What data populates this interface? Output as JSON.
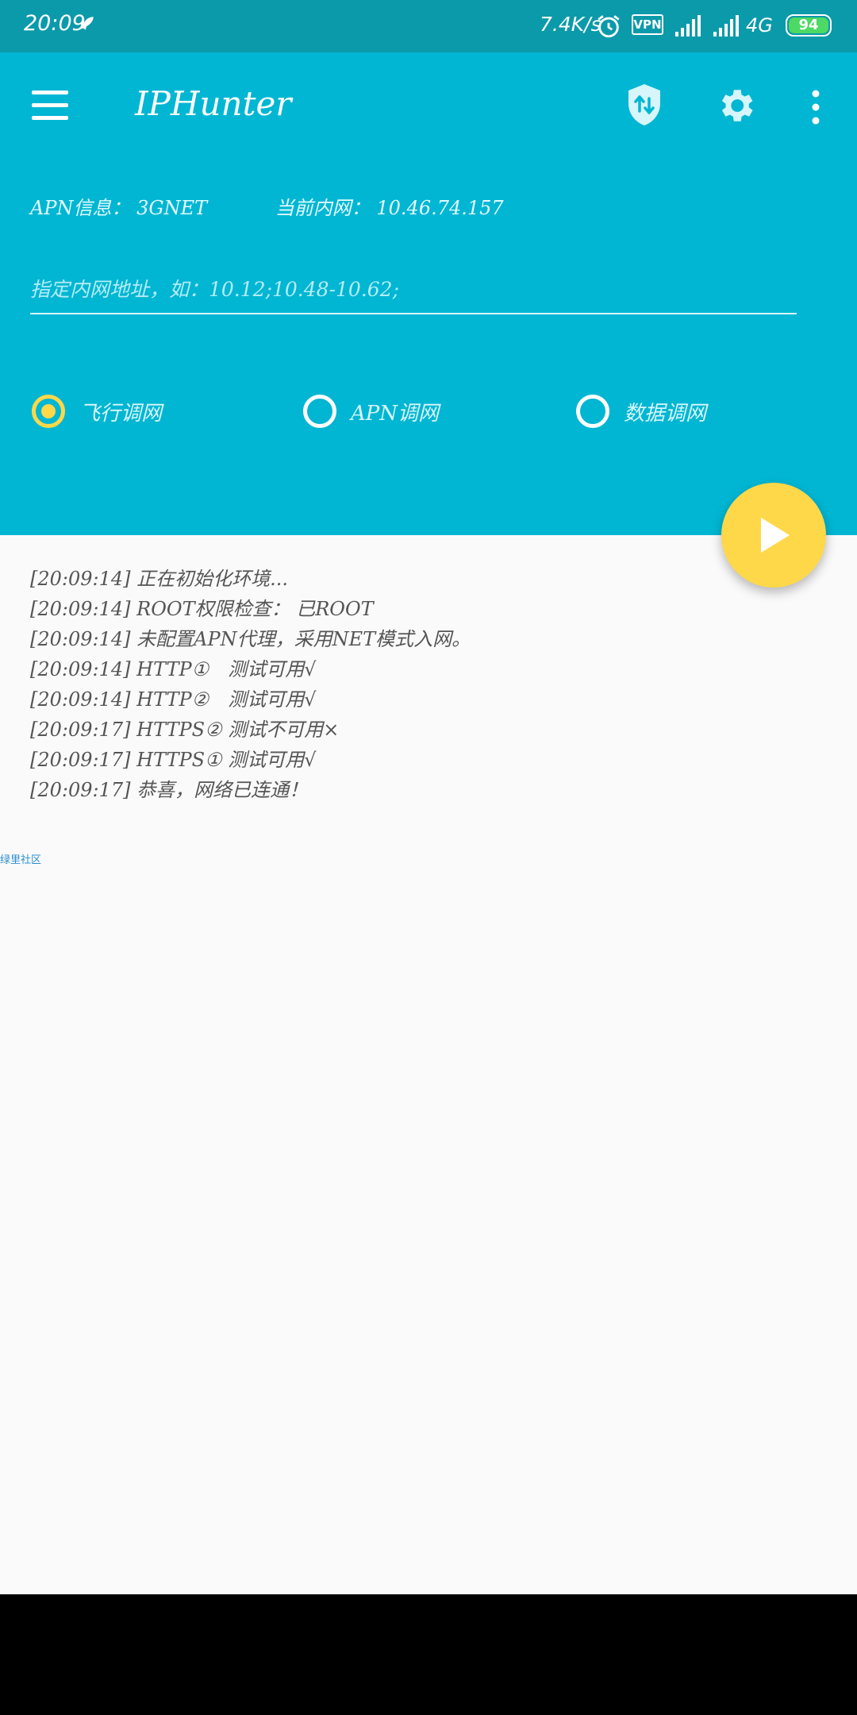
{
  "status_bar": {
    "time": "20:09",
    "net_speed": "7.4K/s",
    "vpn_label": "VPN",
    "network_type": "4G",
    "battery_level": "94",
    "colors": {
      "background": "#0b9aaa",
      "battery_fill": "#4cd964"
    }
  },
  "app": {
    "title": "IPHunter",
    "icons": [
      "menu-icon",
      "shield-swap-icon",
      "gear-icon",
      "more-vert-icon"
    ],
    "colors": {
      "primary": "#00b6d3",
      "accent": "#ffd84a"
    }
  },
  "info": {
    "apn_label": "APN信息：",
    "apn_value": "3GNET",
    "intranet_label": "当前内网：",
    "intranet_value": "10.46.74.157"
  },
  "ip_input": {
    "value": "",
    "placeholder": "指定内网地址，如：10.12;10.48-10.62;"
  },
  "modes": [
    {
      "label": "飞行调网",
      "checked": true
    },
    {
      "label": "APN调网",
      "checked": false
    },
    {
      "label": "数据调网",
      "checked": false
    }
  ],
  "log": [
    "[20:09:14] 正在初始化环境...",
    "[20:09:14] ROOT权限检查： 已ROOT",
    "[20:09:14] 未配置APN代理，采用NET模式入网。",
    "[20:09:14] HTTP①　测试可用√",
    "[20:09:14] HTTP②　测试可用√",
    "[20:09:17] HTTPS② 测试不可用×",
    "[20:09:17] HTTPS① 测试可用√",
    "[20:09:17] 恭喜，网络已连通！"
  ],
  "footer_link": "绿里社区"
}
